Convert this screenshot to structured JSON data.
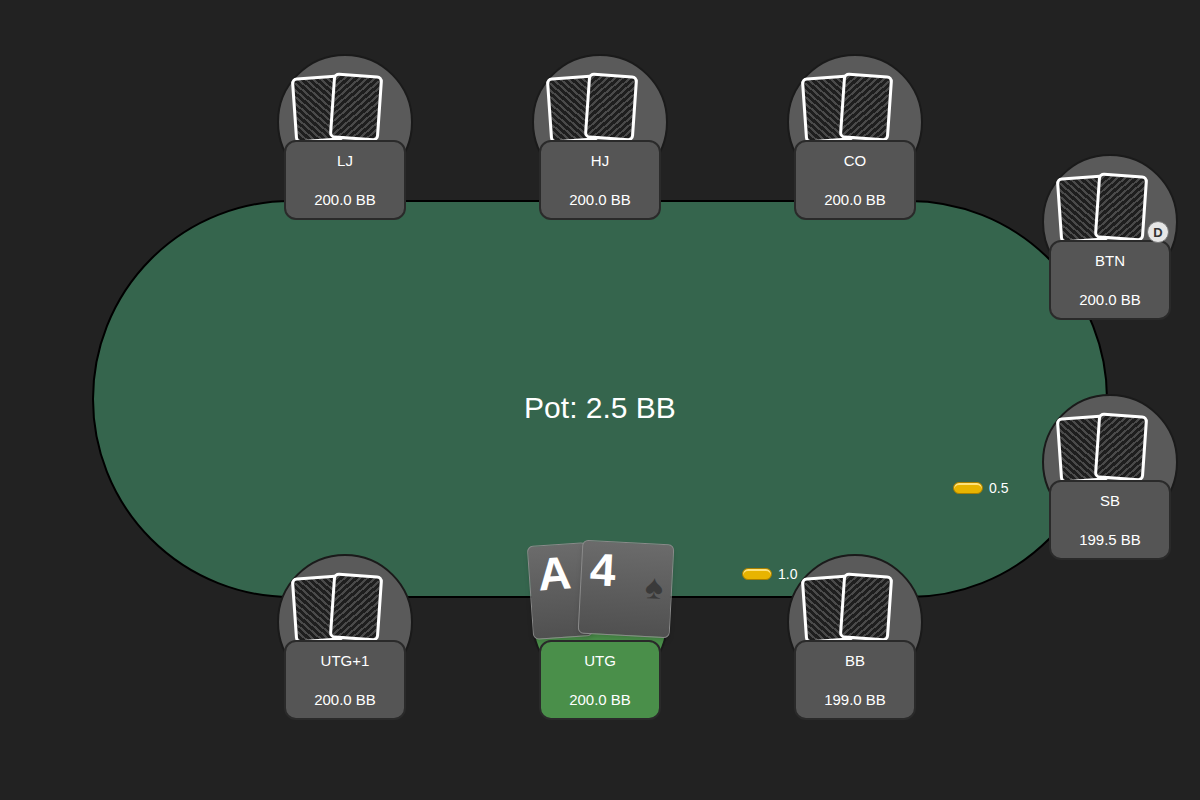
{
  "pot": "Pot: 2.5 BB",
  "dealer_label": "D",
  "seats": [
    {
      "position": "LJ",
      "stack": "200.0 BB",
      "kind": "opponent",
      "active": false,
      "dealer": false
    },
    {
      "position": "HJ",
      "stack": "200.0 BB",
      "kind": "opponent",
      "active": false,
      "dealer": false
    },
    {
      "position": "CO",
      "stack": "200.0 BB",
      "kind": "opponent",
      "active": false,
      "dealer": false
    },
    {
      "position": "BTN",
      "stack": "200.0 BB",
      "kind": "opponent",
      "active": false,
      "dealer": true
    },
    {
      "position": "SB",
      "stack": "199.5 BB",
      "kind": "opponent",
      "active": false,
      "dealer": false,
      "bet": "0.5"
    },
    {
      "position": "BB",
      "stack": "199.0 BB",
      "kind": "opponent",
      "active": false,
      "dealer": false,
      "bet": "1.0"
    },
    {
      "position": "UTG",
      "stack": "200.0 BB",
      "kind": "hero",
      "active": true,
      "dealer": false,
      "cards": [
        {
          "rank": "A",
          "suit": ""
        },
        {
          "rank": "4",
          "suit": "♠"
        }
      ]
    },
    {
      "position": "UTG+1",
      "stack": "200.0 BB",
      "kind": "opponent",
      "active": false,
      "dealer": false
    }
  ]
}
